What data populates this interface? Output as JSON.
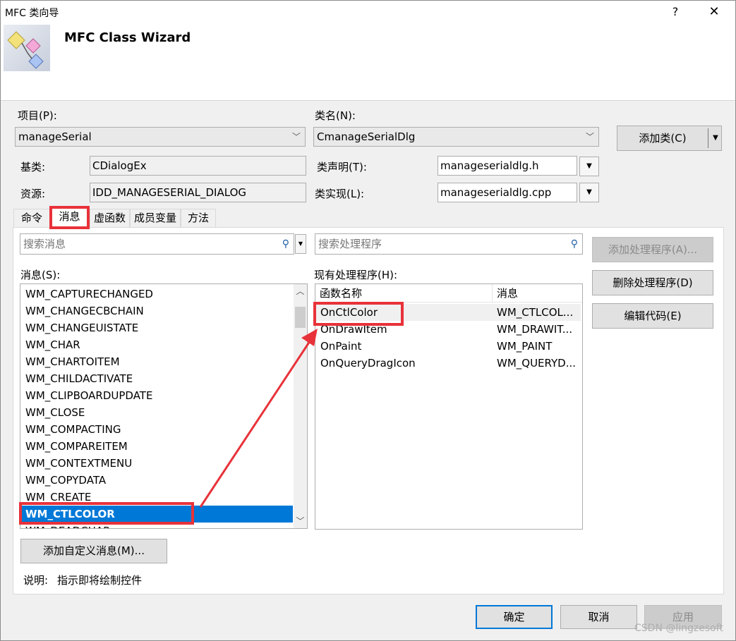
{
  "window": {
    "title": "MFC 类向导",
    "help": "?",
    "close": "✕"
  },
  "banner": {
    "title": "MFC Class Wizard"
  },
  "project": {
    "label": "项目(P):",
    "value": "manageSerial"
  },
  "classname": {
    "label": "类名(N):",
    "value": "CmanageSerialDlg"
  },
  "add_class_button": "添加类(C)",
  "base_class": {
    "label": "基类:",
    "value": "CDialogEx"
  },
  "resource": {
    "label": "资源:",
    "value": "IDD_MANAGESERIAL_DIALOG"
  },
  "class_decl": {
    "label": "类声明(T):",
    "value": "manageserialdlg.h"
  },
  "class_impl": {
    "label": "类实现(L):",
    "value": "manageserialdlg.cpp"
  },
  "tabs": [
    {
      "label": "命令"
    },
    {
      "label": "消息"
    },
    {
      "label": "虚函数"
    },
    {
      "label": "成员变量"
    },
    {
      "label": "方法"
    }
  ],
  "search_messages": {
    "placeholder": "搜索消息"
  },
  "search_handlers": {
    "placeholder": "搜索处理程序"
  },
  "messages_label": "消息(S):",
  "messages": [
    "WM_CAPTURECHANGED",
    "WM_CHANGECBCHAIN",
    "WM_CHANGEUISTATE",
    "WM_CHAR",
    "WM_CHARTOITEM",
    "WM_CHILDACTIVATE",
    "WM_CLIPBOARDUPDATE",
    "WM_CLOSE",
    "WM_COMPACTING",
    "WM_COMPAREITEM",
    "WM_CONTEXTMENU",
    "WM_COPYDATA",
    "WM_CREATE",
    "WM_CTLCOLOR",
    "WM_DEADCHAR"
  ],
  "selected_message": "WM_CTLCOLOR",
  "handlers_label": "现有处理程序(H):",
  "handlers_columns": [
    "函数名称",
    "消息"
  ],
  "handlers": [
    {
      "func": "OnCtlColor",
      "msg": "WM_CTLCOL..."
    },
    {
      "func": "OnDrawItem",
      "msg": "WM_DRAWIT..."
    },
    {
      "func": "OnPaint",
      "msg": "WM_PAINT"
    },
    {
      "func": "OnQueryDragIcon",
      "msg": "WM_QUERYD..."
    }
  ],
  "buttons": {
    "add_handler": "添加处理程序(A)...",
    "delete_handler": "删除处理程序(D)",
    "edit_code": "编辑代码(E)",
    "add_custom_message": "添加自定义消息(M)...",
    "ok": "确定",
    "cancel": "取消",
    "apply": "应用"
  },
  "description": {
    "label": "说明:",
    "text": "指示即将绘制控件"
  },
  "watermark": "CSDN @lingzesoft",
  "colors": {
    "selection": "#0078d7",
    "annotation_red": "#e8323a",
    "dialog_bg": "#f0f0f0"
  }
}
